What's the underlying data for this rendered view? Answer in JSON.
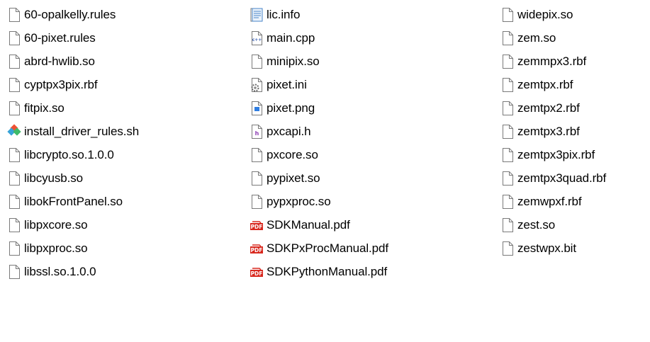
{
  "explorer": {
    "columns": [
      {
        "items": [
          {
            "name": "60-opalkelly.rules",
            "icon": "blank-file-icon"
          },
          {
            "name": "60-pixet.rules",
            "icon": "blank-file-icon"
          },
          {
            "name": "abrd-hwlib.so",
            "icon": "blank-file-icon"
          },
          {
            "name": "cyptpx3pix.rbf",
            "icon": "blank-file-icon"
          },
          {
            "name": "fitpix.so",
            "icon": "blank-file-icon"
          },
          {
            "name": "install_driver_rules.sh",
            "icon": "git-bash-script-icon"
          },
          {
            "name": "libcrypto.so.1.0.0",
            "icon": "blank-file-icon"
          },
          {
            "name": "libcyusb.so",
            "icon": "blank-file-icon"
          },
          {
            "name": "libokFrontPanel.so",
            "icon": "blank-file-icon"
          },
          {
            "name": "libpxcore.so",
            "icon": "blank-file-icon"
          },
          {
            "name": "libpxproc.so",
            "icon": "blank-file-icon"
          },
          {
            "name": "libssl.so.1.0.0",
            "icon": "blank-file-icon"
          }
        ]
      },
      {
        "items": [
          {
            "name": "lic.info",
            "icon": "info-file-icon"
          },
          {
            "name": "main.cpp",
            "icon": "cpp-file-icon"
          },
          {
            "name": "minipix.so",
            "icon": "blank-file-icon"
          },
          {
            "name": "pixet.ini",
            "icon": "settings-file-icon"
          },
          {
            "name": "pixet.png",
            "icon": "image-file-icon"
          },
          {
            "name": "pxcapi.h",
            "icon": "header-file-icon"
          },
          {
            "name": "pxcore.so",
            "icon": "blank-file-icon"
          },
          {
            "name": "pypixet.so",
            "icon": "blank-file-icon"
          },
          {
            "name": "pypxproc.so",
            "icon": "blank-file-icon"
          },
          {
            "name": "SDKManual.pdf",
            "icon": "pdf-file-icon"
          },
          {
            "name": "SDKPxProcManual.pdf",
            "icon": "pdf-file-icon"
          },
          {
            "name": "SDKPythonManual.pdf",
            "icon": "pdf-file-icon"
          }
        ]
      },
      {
        "items": [
          {
            "name": "widepix.so",
            "icon": "blank-file-icon"
          },
          {
            "name": "zem.so",
            "icon": "blank-file-icon"
          },
          {
            "name": "zemmpx3.rbf",
            "icon": "blank-file-icon"
          },
          {
            "name": "zemtpx.rbf",
            "icon": "blank-file-icon"
          },
          {
            "name": "zemtpx2.rbf",
            "icon": "blank-file-icon"
          },
          {
            "name": "zemtpx3.rbf",
            "icon": "blank-file-icon"
          },
          {
            "name": "zemtpx3pix.rbf",
            "icon": "blank-file-icon"
          },
          {
            "name": "zemtpx3quad.rbf",
            "icon": "blank-file-icon"
          },
          {
            "name": "zemwpxf.rbf",
            "icon": "blank-file-icon"
          },
          {
            "name": "zest.so",
            "icon": "blank-file-icon"
          },
          {
            "name": "zestwpx.bit",
            "icon": "blank-file-icon"
          }
        ]
      }
    ]
  },
  "icon_colors": {
    "file_outline": "#7a7a7a",
    "pdf_red": "#d8281e",
    "git_orange": "#f05133",
    "git_blue": "#38a3d8",
    "git_green": "#3fba6a",
    "image_blue": "#2f7de1",
    "header_purple": "#8e3fb4",
    "info_blue": "#4a86c8"
  }
}
